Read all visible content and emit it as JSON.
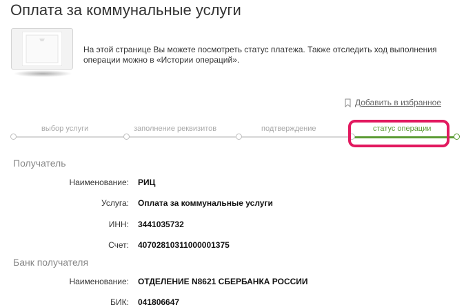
{
  "page": {
    "title": "Оплата за коммунальные услуги",
    "banner_text": "На этой странице Вы можете посмотреть статус платежа. Также отследить ход выполнения операции можно в «Истории операций».",
    "favorites_label": "Добавить в избранное"
  },
  "steps": [
    {
      "label": "выбор услуги",
      "state": "done"
    },
    {
      "label": "заполнение реквизитов",
      "state": "done"
    },
    {
      "label": "подтверждение",
      "state": "done"
    },
    {
      "label": "статус операции",
      "state": "active"
    }
  ],
  "recipient": {
    "title": "Получатель",
    "fields": [
      {
        "label": "Наименование:",
        "value": "РИЦ"
      },
      {
        "label": "Услуга:",
        "value": "Оплата за коммунальные услуги"
      },
      {
        "label": "ИНН:",
        "value": "3441035732"
      },
      {
        "label": "Счет:",
        "value": "40702810311000001375"
      }
    ]
  },
  "bank": {
    "title": "Банк получателя",
    "fields": [
      {
        "label": "Наименование:",
        "value": "ОТДЕЛЕНИЕ N8621 СБЕРБАНКА РОССИИ"
      },
      {
        "label": "БИК:",
        "value": "041806647"
      }
    ]
  },
  "colors": {
    "accent_green": "#5a9a32",
    "highlight": "#e2195f",
    "inactive_step": "#d6d6d6"
  },
  "icons": {
    "banner": "receipt-icon",
    "favorites": "bookmark-icon"
  }
}
